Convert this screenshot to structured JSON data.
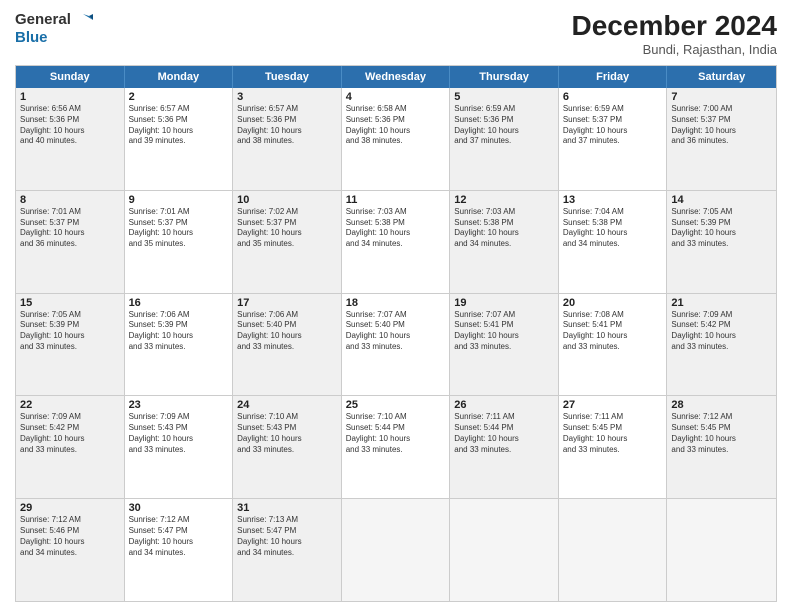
{
  "logo": {
    "line1": "General",
    "line2": "Blue"
  },
  "title": "December 2024",
  "subtitle": "Bundi, Rajasthan, India",
  "days": [
    "Sunday",
    "Monday",
    "Tuesday",
    "Wednesday",
    "Thursday",
    "Friday",
    "Saturday"
  ],
  "rows": [
    [
      {
        "day": "",
        "text": "",
        "empty": true
      },
      {
        "day": "",
        "text": "",
        "empty": true
      },
      {
        "day": "",
        "text": "",
        "empty": true
      },
      {
        "day": "",
        "text": "",
        "empty": true
      },
      {
        "day": "",
        "text": "",
        "empty": true
      },
      {
        "day": "",
        "text": "",
        "empty": true
      },
      {
        "day": "",
        "text": "",
        "empty": true
      }
    ],
    [
      {
        "day": "1",
        "text": "Sunrise: 6:56 AM\nSunset: 5:36 PM\nDaylight: 10 hours\nand 40 minutes.",
        "shaded": true
      },
      {
        "day": "2",
        "text": "Sunrise: 6:57 AM\nSunset: 5:36 PM\nDaylight: 10 hours\nand 39 minutes.",
        "shaded": false
      },
      {
        "day": "3",
        "text": "Sunrise: 6:57 AM\nSunset: 5:36 PM\nDaylight: 10 hours\nand 38 minutes.",
        "shaded": true
      },
      {
        "day": "4",
        "text": "Sunrise: 6:58 AM\nSunset: 5:36 PM\nDaylight: 10 hours\nand 38 minutes.",
        "shaded": false
      },
      {
        "day": "5",
        "text": "Sunrise: 6:59 AM\nSunset: 5:36 PM\nDaylight: 10 hours\nand 37 minutes.",
        "shaded": true
      },
      {
        "day": "6",
        "text": "Sunrise: 6:59 AM\nSunset: 5:37 PM\nDaylight: 10 hours\nand 37 minutes.",
        "shaded": false
      },
      {
        "day": "7",
        "text": "Sunrise: 7:00 AM\nSunset: 5:37 PM\nDaylight: 10 hours\nand 36 minutes.",
        "shaded": true
      }
    ],
    [
      {
        "day": "8",
        "text": "Sunrise: 7:01 AM\nSunset: 5:37 PM\nDaylight: 10 hours\nand 36 minutes.",
        "shaded": true
      },
      {
        "day": "9",
        "text": "Sunrise: 7:01 AM\nSunset: 5:37 PM\nDaylight: 10 hours\nand 35 minutes.",
        "shaded": false
      },
      {
        "day": "10",
        "text": "Sunrise: 7:02 AM\nSunset: 5:37 PM\nDaylight: 10 hours\nand 35 minutes.",
        "shaded": true
      },
      {
        "day": "11",
        "text": "Sunrise: 7:03 AM\nSunset: 5:38 PM\nDaylight: 10 hours\nand 34 minutes.",
        "shaded": false
      },
      {
        "day": "12",
        "text": "Sunrise: 7:03 AM\nSunset: 5:38 PM\nDaylight: 10 hours\nand 34 minutes.",
        "shaded": true
      },
      {
        "day": "13",
        "text": "Sunrise: 7:04 AM\nSunset: 5:38 PM\nDaylight: 10 hours\nand 34 minutes.",
        "shaded": false
      },
      {
        "day": "14",
        "text": "Sunrise: 7:05 AM\nSunset: 5:39 PM\nDaylight: 10 hours\nand 33 minutes.",
        "shaded": true
      }
    ],
    [
      {
        "day": "15",
        "text": "Sunrise: 7:05 AM\nSunset: 5:39 PM\nDaylight: 10 hours\nand 33 minutes.",
        "shaded": true
      },
      {
        "day": "16",
        "text": "Sunrise: 7:06 AM\nSunset: 5:39 PM\nDaylight: 10 hours\nand 33 minutes.",
        "shaded": false
      },
      {
        "day": "17",
        "text": "Sunrise: 7:06 AM\nSunset: 5:40 PM\nDaylight: 10 hours\nand 33 minutes.",
        "shaded": true
      },
      {
        "day": "18",
        "text": "Sunrise: 7:07 AM\nSunset: 5:40 PM\nDaylight: 10 hours\nand 33 minutes.",
        "shaded": false
      },
      {
        "day": "19",
        "text": "Sunrise: 7:07 AM\nSunset: 5:41 PM\nDaylight: 10 hours\nand 33 minutes.",
        "shaded": true
      },
      {
        "day": "20",
        "text": "Sunrise: 7:08 AM\nSunset: 5:41 PM\nDaylight: 10 hours\nand 33 minutes.",
        "shaded": false
      },
      {
        "day": "21",
        "text": "Sunrise: 7:09 AM\nSunset: 5:42 PM\nDaylight: 10 hours\nand 33 minutes.",
        "shaded": true
      }
    ],
    [
      {
        "day": "22",
        "text": "Sunrise: 7:09 AM\nSunset: 5:42 PM\nDaylight: 10 hours\nand 33 minutes.",
        "shaded": true
      },
      {
        "day": "23",
        "text": "Sunrise: 7:09 AM\nSunset: 5:43 PM\nDaylight: 10 hours\nand 33 minutes.",
        "shaded": false
      },
      {
        "day": "24",
        "text": "Sunrise: 7:10 AM\nSunset: 5:43 PM\nDaylight: 10 hours\nand 33 minutes.",
        "shaded": true
      },
      {
        "day": "25",
        "text": "Sunrise: 7:10 AM\nSunset: 5:44 PM\nDaylight: 10 hours\nand 33 minutes.",
        "shaded": false
      },
      {
        "day": "26",
        "text": "Sunrise: 7:11 AM\nSunset: 5:44 PM\nDaylight: 10 hours\nand 33 minutes.",
        "shaded": true
      },
      {
        "day": "27",
        "text": "Sunrise: 7:11 AM\nSunset: 5:45 PM\nDaylight: 10 hours\nand 33 minutes.",
        "shaded": false
      },
      {
        "day": "28",
        "text": "Sunrise: 7:12 AM\nSunset: 5:45 PM\nDaylight: 10 hours\nand 33 minutes.",
        "shaded": true
      }
    ],
    [
      {
        "day": "29",
        "text": "Sunrise: 7:12 AM\nSunset: 5:46 PM\nDaylight: 10 hours\nand 34 minutes.",
        "shaded": true
      },
      {
        "day": "30",
        "text": "Sunrise: 7:12 AM\nSunset: 5:47 PM\nDaylight: 10 hours\nand 34 minutes.",
        "shaded": false
      },
      {
        "day": "31",
        "text": "Sunrise: 7:13 AM\nSunset: 5:47 PM\nDaylight: 10 hours\nand 34 minutes.",
        "shaded": true
      },
      {
        "day": "",
        "text": "",
        "empty": true
      },
      {
        "day": "",
        "text": "",
        "empty": true
      },
      {
        "day": "",
        "text": "",
        "empty": true
      },
      {
        "day": "",
        "text": "",
        "empty": true
      }
    ]
  ]
}
